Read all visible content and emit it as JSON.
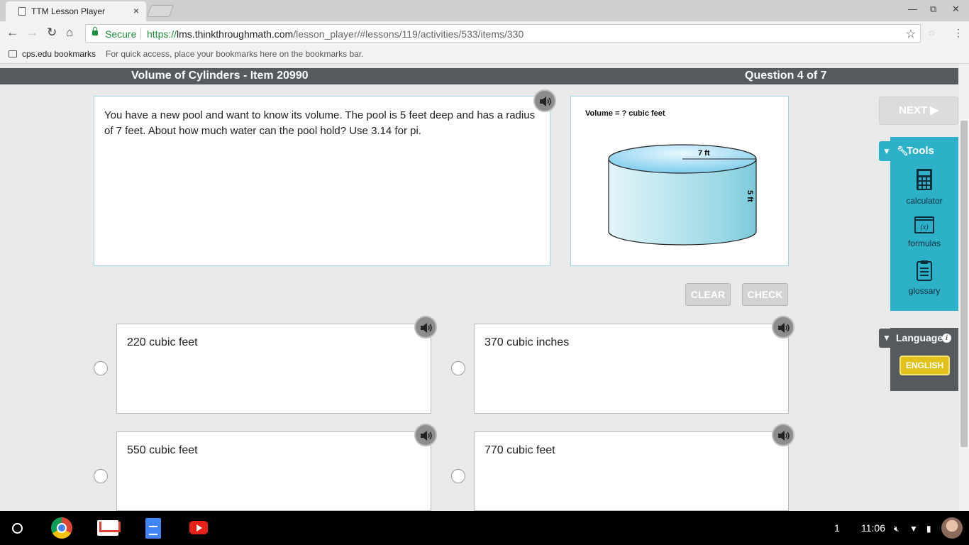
{
  "browser": {
    "tab_title": "TTM Lesson Player",
    "tab_close": "×",
    "nav_back": "←",
    "nav_forward": "→",
    "nav_reload": "↻",
    "nav_home": "⌂",
    "secure_label": "Secure",
    "url_scheme": "https://",
    "url_host": "lms.thinkthroughmath.com",
    "url_path": "/lesson_player/#lessons/119/activities/533/items/330",
    "bookmark_folder": "cps.edu bookmarks",
    "bookmark_hint": "For quick access, place your bookmarks here on the bookmarks bar.",
    "window_controls": [
      "—",
      "⧉",
      "✕"
    ]
  },
  "header": {
    "title": "Volume of Cylinders - Item 20990",
    "question_count": "Question 4 of 7"
  },
  "question": {
    "text": "You have a new pool and want to know its volume. The pool is 5 feet deep and has a radius of 7 feet. About how much water can the pool hold? Use 3.14 for pi.",
    "image_caption": "Volume = ? cubic feet",
    "radius_label": "7 ft",
    "height_label": "5 ft"
  },
  "actions": {
    "clear_label": "CLEAR",
    "check_label": "CHECK",
    "next_label": "NEXT ▶"
  },
  "choices": [
    {
      "text": "220 cubic feet"
    },
    {
      "text": "370 cubic inches"
    },
    {
      "text": "550 cubic feet"
    },
    {
      "text": "770 cubic feet"
    }
  ],
  "tools": {
    "heading": "Tools",
    "items": [
      {
        "label": "calculator",
        "icon": "calculator-icon"
      },
      {
        "label": "formulas",
        "icon": "formulas-icon"
      },
      {
        "label": "glossary",
        "icon": "glossary-icon"
      }
    ]
  },
  "language": {
    "heading": "Language",
    "button": "ENGLISH"
  },
  "shelf": {
    "notification_count": "1",
    "time": "11:06"
  },
  "colors": {
    "accent_teal": "#2cb1c8",
    "header_gray": "#555a5e",
    "english_yellow": "#e2c21a"
  }
}
